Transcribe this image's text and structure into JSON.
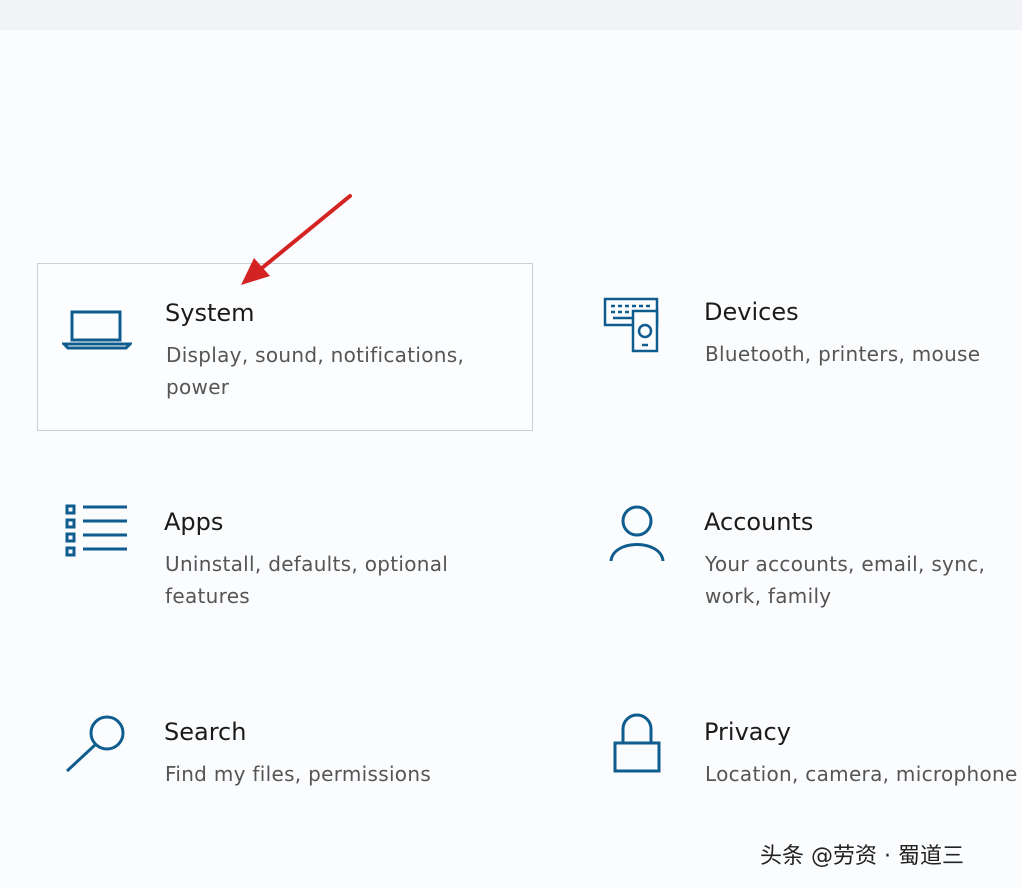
{
  "settings": {
    "tiles": [
      {
        "title": "System",
        "desc": "Display, sound, notifications, power",
        "icon": "laptop-icon"
      },
      {
        "title": "Devices",
        "desc": "Bluetooth, printers, mouse",
        "icon": "devices-icon"
      },
      {
        "title": "Apps",
        "desc": "Uninstall, defaults, optional features",
        "icon": "apps-list-icon"
      },
      {
        "title": "Accounts",
        "desc": "Your accounts, email, sync, work, family",
        "icon": "person-icon"
      },
      {
        "title": "Search",
        "desc": "Find my files, permissions",
        "icon": "search-icon"
      },
      {
        "title": "Privacy",
        "desc": "Location, camera, microphone",
        "icon": "lock-icon"
      }
    ]
  },
  "colors": {
    "icon": "#0f5c8e",
    "annotation_arrow": "#d42323",
    "selected_border": "#c9cfd8"
  },
  "watermark": "头条 @劳资 · 蜀道三"
}
